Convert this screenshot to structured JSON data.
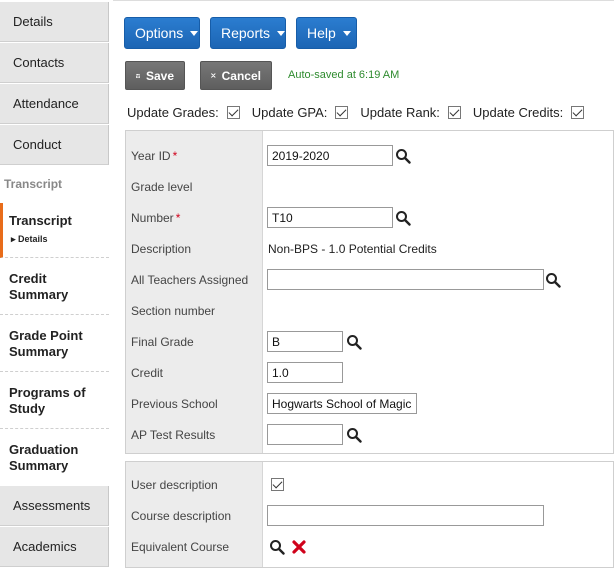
{
  "sidebar": {
    "tabs_top": [
      "Details",
      "Contacts",
      "Attendance",
      "Conduct"
    ],
    "section_label": "Transcript",
    "subitems": [
      {
        "label": "Transcript",
        "detail": "▸ Details"
      },
      {
        "label": "Credit Summary"
      },
      {
        "label": "Grade Point Summary"
      },
      {
        "label": "Programs of Study"
      },
      {
        "label": "Graduation Summary"
      }
    ],
    "tabs_bottom": [
      "Assessments",
      "Academics"
    ]
  },
  "menus": {
    "options": "Options",
    "reports": "Reports",
    "help": "Help"
  },
  "actions": {
    "save": "Save",
    "cancel": "Cancel",
    "autosave": "Auto-saved at 6:19 AM"
  },
  "update_flags": [
    {
      "label": "Update Grades:",
      "checked": true
    },
    {
      "label": "Update GPA:",
      "checked": true
    },
    {
      "label": "Update Rank:",
      "checked": true
    },
    {
      "label": "Update Credits:",
      "checked": true
    }
  ],
  "form": {
    "year_id": {
      "label": "Year ID",
      "value": "2019-2020"
    },
    "grade_level": {
      "label": "Grade level"
    },
    "number": {
      "label": "Number",
      "value": "T10"
    },
    "description": {
      "label": "Description",
      "value": "Non-BPS - 1.0 Potential Credits"
    },
    "all_teachers": {
      "label": "All Teachers Assigned",
      "value": ""
    },
    "section_number": {
      "label": "Section number"
    },
    "final_grade": {
      "label": "Final Grade",
      "value": "B"
    },
    "credit": {
      "label": "Credit",
      "value": "1.0"
    },
    "previous_school": {
      "label": "Previous School",
      "value": "Hogwarts School of Magic"
    },
    "ap_test": {
      "label": "AP Test Results",
      "value": ""
    }
  },
  "form2": {
    "user_description": {
      "label": "User description",
      "checked": true
    },
    "course_description": {
      "label": "Course description",
      "value": ""
    },
    "equivalent_course": {
      "label": "Equivalent Course"
    }
  },
  "colors": {
    "accent": "#1c65b4",
    "active_marker": "#e86c1a",
    "autosave": "#2e8b2e",
    "delete": "#d0021b"
  }
}
